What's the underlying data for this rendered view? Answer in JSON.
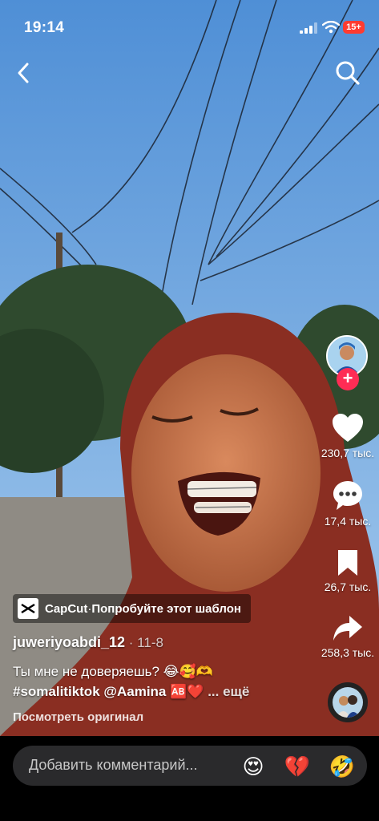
{
  "status": {
    "time": "19:14",
    "battery": "15+"
  },
  "nav": {
    "back_icon": "chevron-left-icon",
    "search_icon": "search-icon"
  },
  "rail": {
    "likes": "230,7 тыс.",
    "comments": "17,4 тыс.",
    "saves": "26,7 тыс.",
    "shares": "258,3 тыс.",
    "follow_plus": "+",
    "like_color": "#ffffff",
    "follow_color": "#fe2c55"
  },
  "capcut": {
    "brand": "CapCut",
    "separator": " · ",
    "cta": "Попробуйте этот шаблон"
  },
  "post": {
    "author": "juweriyoabdi_12",
    "date": " · 11-8",
    "caption_line1": "Ты мне не доверяешь? 😂🥰🫶",
    "hashtag": "#somalitiktok",
    "mention": "@Aamina",
    "caption_emoji": "🆎❤️",
    "more": " ... ещё",
    "view_original": "Посмотреть оригинал"
  },
  "comment_bar": {
    "placeholder": "Добавить комментарий...",
    "quick_emojis": [
      "😍",
      "💔",
      "🤣"
    ]
  }
}
